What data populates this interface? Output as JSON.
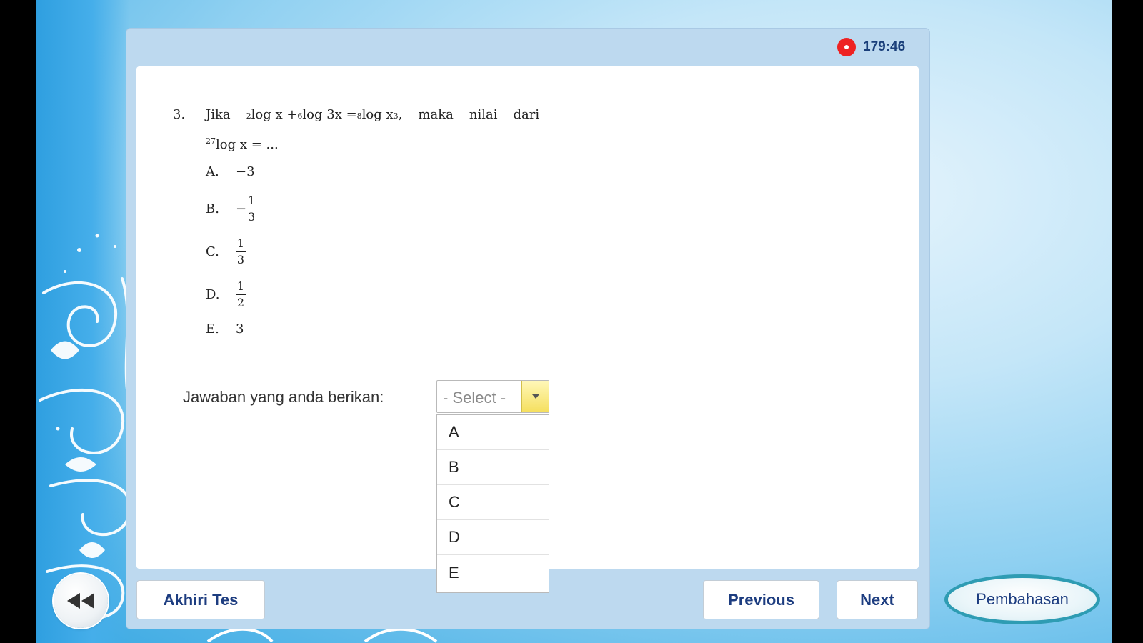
{
  "timer": {
    "value": "179:46"
  },
  "question": {
    "number": "3.",
    "intro": "Jika",
    "b1": "2",
    "p1": "log x +",
    "b2": "6",
    "p2": "log 3x =",
    "b3": "8",
    "p3": "log x",
    "exp3": "3",
    "p4": ",",
    "maka": "maka",
    "nilai": "nilai",
    "dari": "dari",
    "b4": "27",
    "p5": "log x = ..."
  },
  "options": [
    {
      "letter": "A.",
      "value": "−3"
    },
    {
      "letter": "B.",
      "sign": "−",
      "num": "1",
      "den": "3"
    },
    {
      "letter": "C.",
      "num": "1",
      "den": "3"
    },
    {
      "letter": "D.",
      "num": "1",
      "den": "2"
    },
    {
      "letter": "E.",
      "value": "3"
    }
  ],
  "answer": {
    "label": "Jawaban yang anda berikan:",
    "selected": "- Select -",
    "choices": [
      "A",
      "B",
      "C",
      "D",
      "E"
    ]
  },
  "buttons": {
    "end_test": "Akhiri Tes",
    "previous": "Previous",
    "next": "Next",
    "discussion": "Pembahasan"
  },
  "icons": {
    "timer": "record-icon",
    "back": "rewind-icon",
    "dropdown": "chevron-down-icon"
  },
  "colors": {
    "accent_text": "#1d3d80",
    "timer_dot": "#ee2222",
    "dropdown_arrow_bg": "#f5df5e",
    "discussion_ring": "#2e9cb3"
  }
}
